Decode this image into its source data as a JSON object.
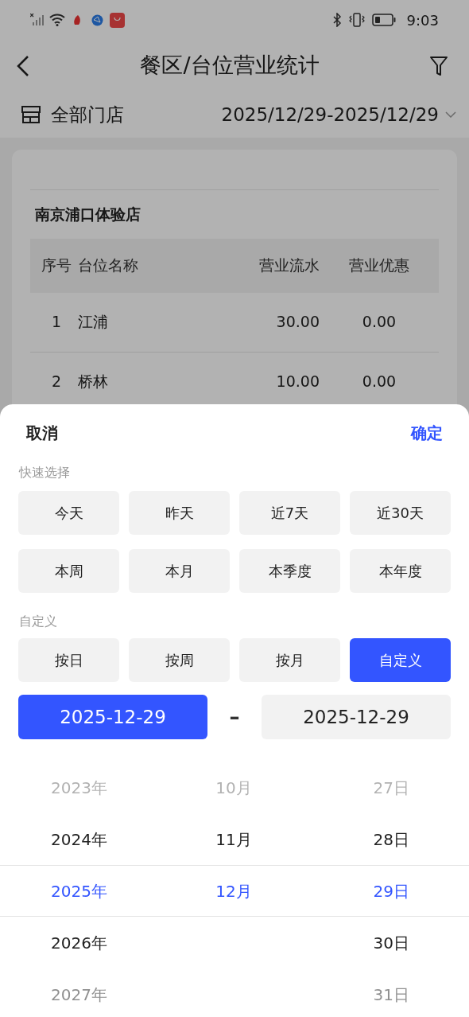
{
  "status_bar": {
    "time": "9:03"
  },
  "header": {
    "title": "餐区/台位营业统计"
  },
  "filter_bar": {
    "store": "全部门店",
    "date_range": "2025/12/29-2025/12/29"
  },
  "report": {
    "store_name": "南京浦口体验店",
    "table": {
      "columns": [
        "序号",
        "台位名称",
        "营业流水",
        "营业优惠"
      ],
      "rows": [
        {
          "cells": [
            "1",
            "江浦",
            "30.00",
            "0.00"
          ]
        },
        {
          "cells": [
            "2",
            "桥林",
            "10.00",
            "0.00"
          ]
        }
      ]
    }
  },
  "sheet": {
    "cancel": "取消",
    "confirm": "确定",
    "quick_label": "快速选择",
    "quick_options": [
      {
        "label": "今天",
        "selected": false
      },
      {
        "label": "昨天",
        "selected": false
      },
      {
        "label": "近7天",
        "selected": false
      },
      {
        "label": "近30天",
        "selected": false
      },
      {
        "label": "本周",
        "selected": false
      },
      {
        "label": "本月",
        "selected": false
      },
      {
        "label": "本季度",
        "selected": false
      },
      {
        "label": "本年度",
        "selected": false
      }
    ],
    "custom_label": "自定义",
    "custom_options": [
      {
        "label": "按日",
        "selected": false
      },
      {
        "label": "按周",
        "selected": false
      },
      {
        "label": "按月",
        "selected": false
      },
      {
        "label": "自定义",
        "selected": true
      }
    ],
    "date_fields": [
      {
        "value": "2025-12-29",
        "selected": true
      },
      {
        "value": "2025-12-29",
        "selected": false
      }
    ],
    "separator": "–",
    "picker": [
      {
        "items": [
          {
            "label": "2023年",
            "selected": false
          },
          {
            "label": "2024年",
            "selected": false
          },
          {
            "label": "2025年",
            "selected": true
          },
          {
            "label": "2026年",
            "selected": false
          },
          {
            "label": "2027年",
            "selected": false
          }
        ]
      },
      {
        "items": [
          {
            "label": "10月",
            "selected": false
          },
          {
            "label": "11月",
            "selected": false
          },
          {
            "label": "12月",
            "selected": true
          }
        ]
      },
      {
        "items": [
          {
            "label": "27日",
            "selected": false
          },
          {
            "label": "28日",
            "selected": false
          },
          {
            "label": "29日",
            "selected": true
          },
          {
            "label": "30日",
            "selected": false
          },
          {
            "label": "31日",
            "selected": false
          }
        ]
      }
    ]
  }
}
